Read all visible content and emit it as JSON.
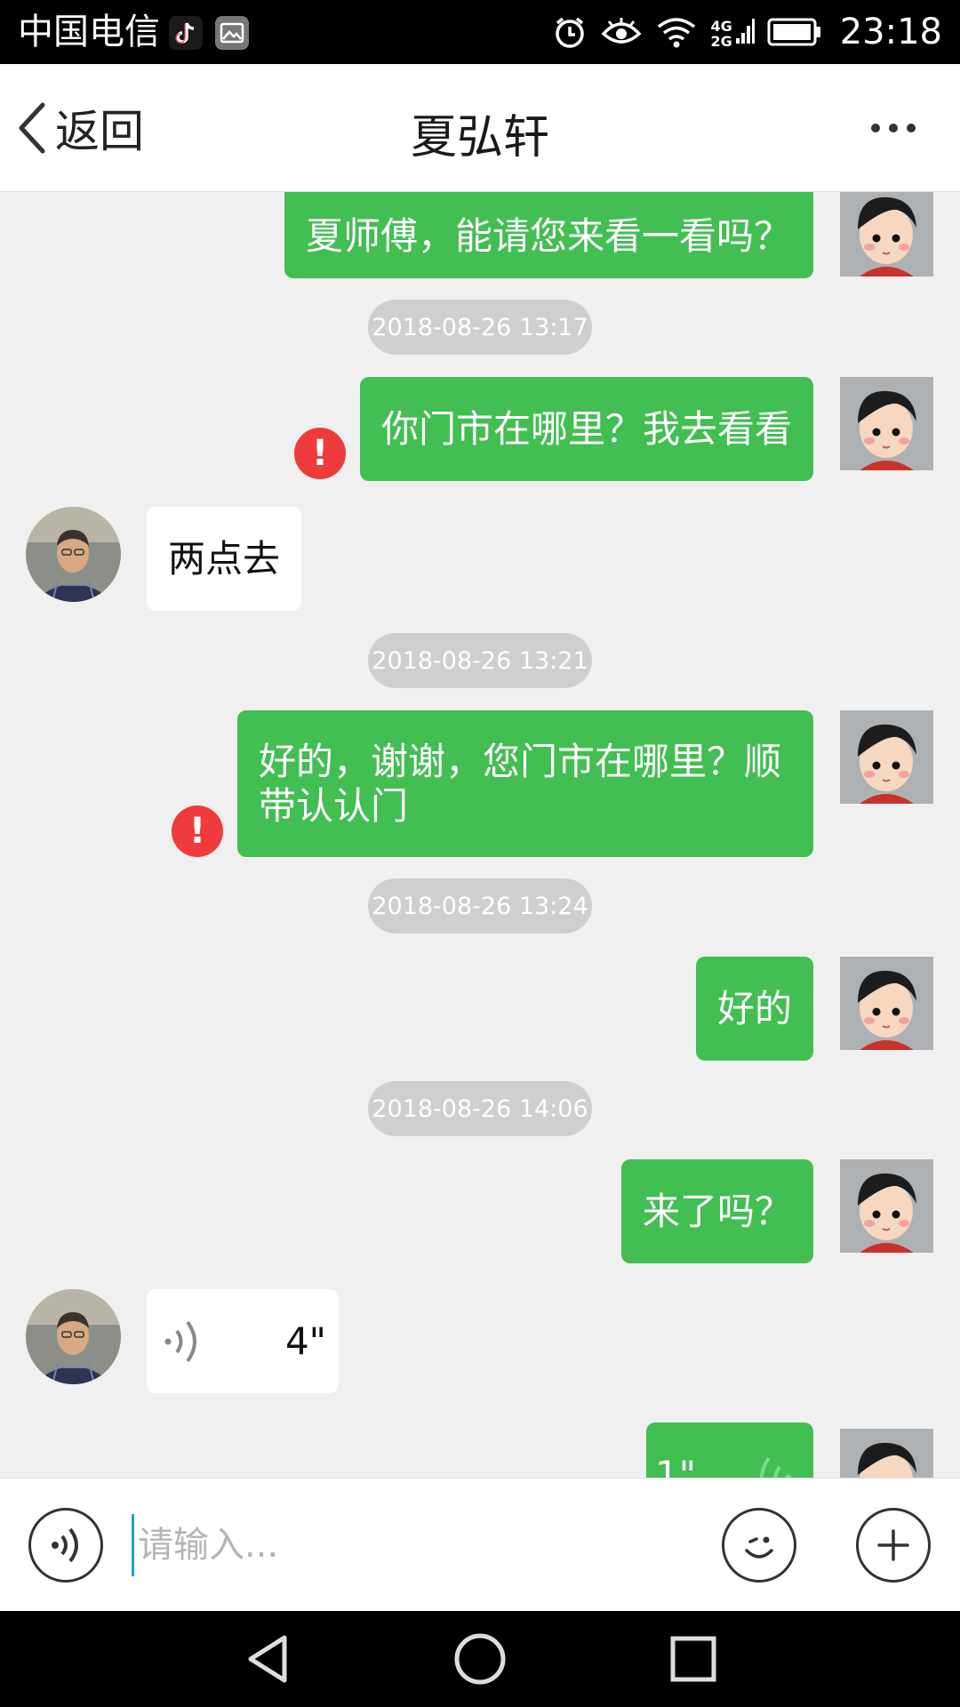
{
  "status_bar": {
    "carrier": "中国电信",
    "network_4g": "4G",
    "network_2g": "2G",
    "time": "23:18"
  },
  "header": {
    "back_label": "返回",
    "title": "夏弘轩"
  },
  "messages": {
    "m1": "夏师傅，能请您来看一看吗？",
    "ts1": "2018-08-26 13:17",
    "m2": "你门市在哪里？我去看看",
    "m3": "两点去",
    "ts2": "2018-08-26 13:21",
    "m4": "好的，谢谢，您门市在哪里？顺带认认门",
    "ts3": "2018-08-26 13:24",
    "m5": "好的",
    "ts4": "2018-08-26 14:06",
    "m6": "来了吗？",
    "voice_in_duration": "4\"",
    "voice_out_duration": "1\"",
    "error_mark": "!"
  },
  "input": {
    "placeholder": "请输入..."
  },
  "colors": {
    "bubble_self": "#42be53",
    "bubble_other": "#ffffff",
    "error": "#ef3b3b",
    "background": "#f0f0f0"
  },
  "icons": [
    "back-chevron-icon",
    "more-icon",
    "voice-icon",
    "emoji-icon",
    "plus-icon",
    "error-icon",
    "back-nav-icon",
    "home-nav-icon",
    "recents-nav-icon"
  ]
}
